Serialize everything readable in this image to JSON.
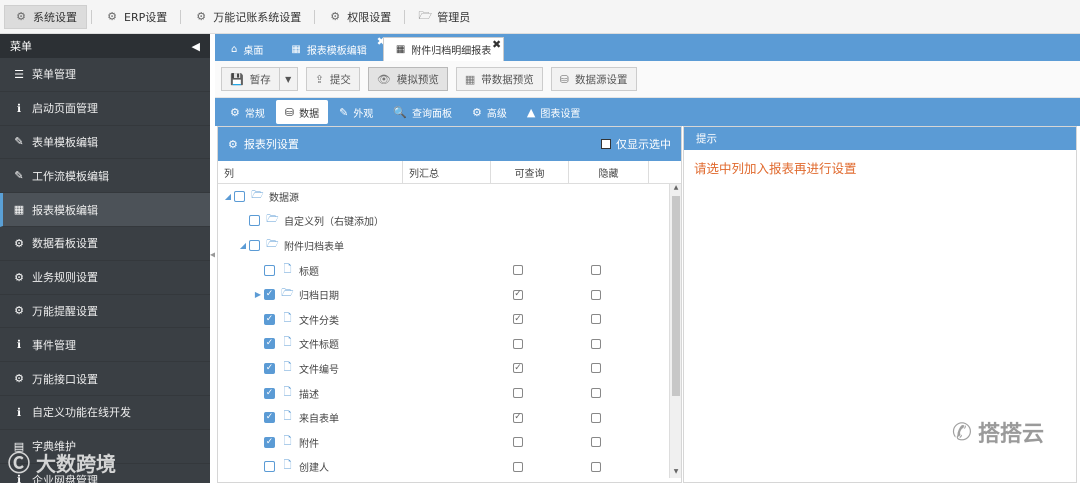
{
  "topnav": {
    "items": [
      {
        "label": "系统设置",
        "icon": "gear-icon",
        "glyph": "⚙"
      },
      {
        "label": "ERP设置",
        "icon": "gear-icon",
        "glyph": "⚙"
      },
      {
        "label": "万能记账系统设置",
        "icon": "gear-icon",
        "glyph": "⚙"
      },
      {
        "label": "权限设置",
        "icon": "gear-icon",
        "glyph": "⚙"
      },
      {
        "label": "管理员",
        "icon": "folder-icon",
        "glyph": "🗁"
      }
    ]
  },
  "sidebar": {
    "header": "菜单",
    "collapse_glyph": "◀",
    "items": [
      {
        "label": "菜单管理",
        "glyph": "☰"
      },
      {
        "label": "启动页面管理",
        "glyph": "ℹ"
      },
      {
        "label": "表单模板编辑",
        "glyph": "✎"
      },
      {
        "label": "工作流模板编辑",
        "glyph": "✎"
      },
      {
        "label": "报表模板编辑",
        "glyph": "▦"
      },
      {
        "label": "数据看板设置",
        "glyph": "⚙"
      },
      {
        "label": "业务规则设置",
        "glyph": "⚙"
      },
      {
        "label": "万能提醒设置",
        "glyph": "⚙"
      },
      {
        "label": "事件管理",
        "glyph": "ℹ"
      },
      {
        "label": "万能接口设置",
        "glyph": "⚙"
      },
      {
        "label": "自定义功能在线开发",
        "glyph": "ℹ"
      },
      {
        "label": "字典维护",
        "glyph": "▤"
      },
      {
        "label": "企业网盘管理",
        "glyph": "ℹ"
      }
    ]
  },
  "tabs": [
    {
      "label": "桌面",
      "glyph": "⌂"
    },
    {
      "label": "报表模板编辑",
      "glyph": "▦",
      "close": "✖"
    },
    {
      "label": "附件归档明细报表",
      "glyph": "▦",
      "close": "✖"
    }
  ],
  "toolbar": {
    "save": "暂存",
    "save_glyph": "💾",
    "dropdown_glyph": "▼",
    "submit": "提交",
    "submit_glyph": "⇪",
    "preview": "模拟预览",
    "preview_glyph": "👁",
    "data_preview": "带数据预览",
    "data_preview_glyph": "▦",
    "datasource": "数据源设置",
    "datasource_glyph": "⛁"
  },
  "subtabs": [
    {
      "label": "常规",
      "glyph": "⚙"
    },
    {
      "label": "数据",
      "glyph": "⛁"
    },
    {
      "label": "外观",
      "glyph": "✎"
    },
    {
      "label": "查询面板",
      "glyph": "🔍"
    },
    {
      "label": "高级",
      "glyph": "⚙"
    },
    {
      "label": "图表设置",
      "glyph": "▲"
    }
  ],
  "column_panel": {
    "title": "报表列设置",
    "title_glyph": "⚙",
    "only_selected": "仅显示选中",
    "headers": {
      "col": "列",
      "summary": "列汇总",
      "queryable": "可查询",
      "hidden": "隐藏"
    }
  },
  "tree": [
    {
      "label": "数据源",
      "level": 0,
      "arrow": "◢",
      "checked": false,
      "type": "folder"
    },
    {
      "label": "自定义列（右键添加）",
      "level": 1,
      "arrow": "",
      "checked": false,
      "type": "folder"
    },
    {
      "label": "附件归档表单",
      "level": 1,
      "arrow": "◢",
      "checked": false,
      "type": "folder"
    },
    {
      "label": "标题",
      "level": 2,
      "arrow": "",
      "checked": false,
      "type": "file",
      "queryable": false,
      "hidden": false
    },
    {
      "label": "归档日期",
      "level": 2,
      "arrow": "▶",
      "checked": true,
      "type": "folder",
      "queryable": true,
      "hidden": false
    },
    {
      "label": "文件分类",
      "level": 2,
      "arrow": "",
      "checked": true,
      "type": "file",
      "queryable": true,
      "hidden": false
    },
    {
      "label": "文件标题",
      "level": 2,
      "arrow": "",
      "checked": true,
      "type": "file",
      "queryable": false,
      "hidden": false
    },
    {
      "label": "文件编号",
      "level": 2,
      "arrow": "",
      "checked": true,
      "type": "file",
      "queryable": true,
      "hidden": false
    },
    {
      "label": "描述",
      "level": 2,
      "arrow": "",
      "checked": true,
      "type": "file",
      "queryable": false,
      "hidden": false
    },
    {
      "label": "来自表单",
      "level": 2,
      "arrow": "",
      "checked": true,
      "type": "file",
      "queryable": true,
      "hidden": false
    },
    {
      "label": "附件",
      "level": 2,
      "arrow": "",
      "checked": true,
      "type": "file",
      "queryable": false,
      "hidden": false
    },
    {
      "label": "创建人",
      "level": 2,
      "arrow": "",
      "checked": false,
      "type": "file",
      "queryable": false,
      "hidden": false
    }
  ],
  "hint_panel": {
    "title": "提示",
    "message": "请选中列加入报表再进行设置"
  },
  "watermarks": {
    "right": "搭搭云",
    "right_glyph": "✆",
    "left": "大数跨境",
    "left_glyph": "Ⓒ"
  }
}
